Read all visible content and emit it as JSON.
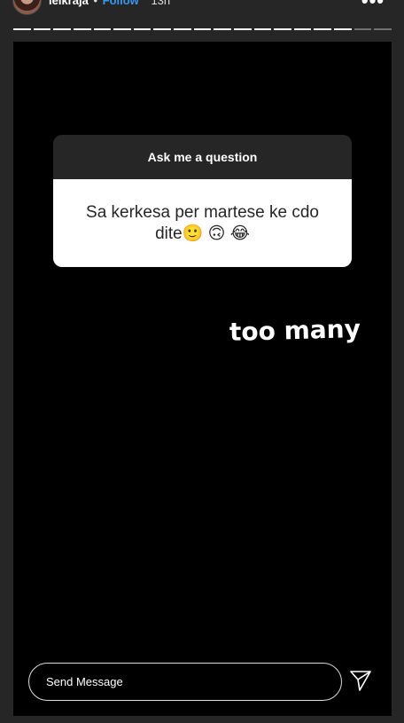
{
  "header": {
    "username": "leikraja",
    "separator": "•",
    "follow_label": "Follow",
    "time": "13h",
    "more_label": "•••"
  },
  "progress": {
    "total_segments": 19,
    "completed_segments": 17
  },
  "sticker": {
    "title": "Ask me a question",
    "answer": "Sa kerkesa per martese ke cdo dite🙂 🙃 😂"
  },
  "caption": {
    "emoji": "😂😂😂😂😂",
    "text": "too many"
  },
  "message_bar": {
    "placeholder": "Send Message",
    "send_icon": "paper-plane-icon"
  },
  "colors": {
    "background": "#262626",
    "story_background": "#000000",
    "link": "#3897f0"
  }
}
